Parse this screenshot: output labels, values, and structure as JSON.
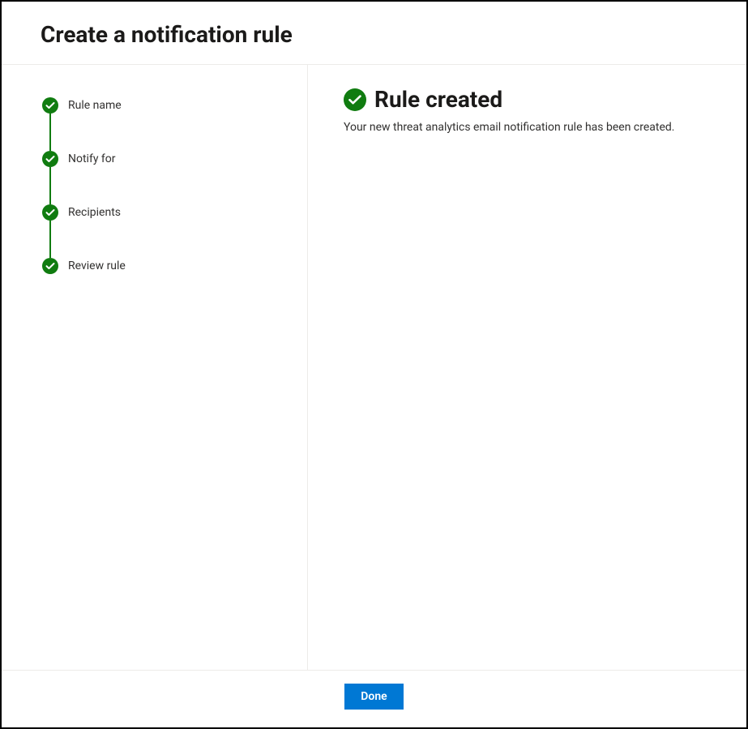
{
  "header": {
    "title": "Create a notification rule"
  },
  "sidebar": {
    "steps": [
      {
        "label": "Rule name",
        "status": "complete"
      },
      {
        "label": "Notify for",
        "status": "complete"
      },
      {
        "label": "Recipients",
        "status": "complete"
      },
      {
        "label": "Review rule",
        "status": "complete"
      }
    ]
  },
  "main": {
    "heading": "Rule created",
    "subtext": "Your new threat analytics email notification rule has been created."
  },
  "footer": {
    "done_label": "Done"
  },
  "colors": {
    "success_green": "#107c10",
    "primary_blue": "#0078d4"
  }
}
